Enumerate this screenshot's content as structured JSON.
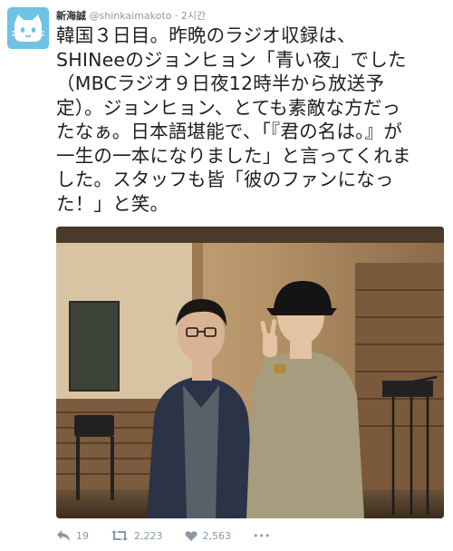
{
  "tweet": {
    "author": {
      "name": "新海誠",
      "handle": "@shinkaimakoto",
      "avatar_icon": "cat-face-icon"
    },
    "separator": "·",
    "time": "2시간",
    "text_lines": [
      "韓国３日目。昨晩のラジオ収録は、",
      "SHINeeのジョンヒョン「青い夜」でした",
      "（MBCラジオ９日夜12時半から放送予",
      "定）。ジョンヒョン、とても素敵な方だっ",
      "たなぁ。日本語堪能で、「『君の名は。』が",
      "一生の一本になりました」と言ってくれま",
      "した。スタッフも皆「彼のファンになっ",
      "た！」と笑。"
    ],
    "photo": {
      "description_icon": "studio-photo"
    },
    "actions": {
      "reply_count": "19",
      "retweet_count": "2,223",
      "like_count": "2,563",
      "more_label": "•••"
    },
    "colors": {
      "meta_gray": "#8899a6",
      "avatar_blue": "#6ec2e6"
    }
  }
}
